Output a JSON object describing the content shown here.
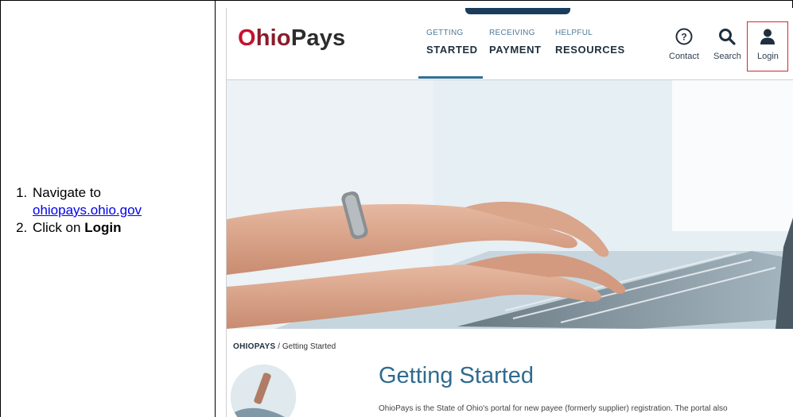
{
  "instructions": {
    "step1_text": "Navigate to",
    "step1_link": "ohiopays.ohio.gov",
    "step2_prefix": "Click on ",
    "step2_bold": "Login"
  },
  "site": {
    "logo": {
      "o": "O",
      "hio": "hio",
      "pays": "Pays"
    },
    "nav": [
      {
        "small": "GETTING",
        "big": "STARTED"
      },
      {
        "small": "RECEIVING",
        "big": "PAYMENT"
      },
      {
        "small": "HELPFUL",
        "big": "RESOURCES"
      }
    ],
    "utility": {
      "contact": "Contact",
      "search": "Search",
      "login": "Login"
    },
    "breadcrumb": {
      "home": "OHIOPAYS",
      "separator": " / ",
      "current": "Getting Started"
    },
    "page_title": "Getting Started",
    "intro": "OhioPays is the State of Ohio's portal for new payee (formerly supplier) registration. The portal also"
  },
  "colors": {
    "link": "#0000ee",
    "logo_red": "#c8102e",
    "title_blue": "#2f6b8f",
    "login_highlight": "#d9262c"
  }
}
